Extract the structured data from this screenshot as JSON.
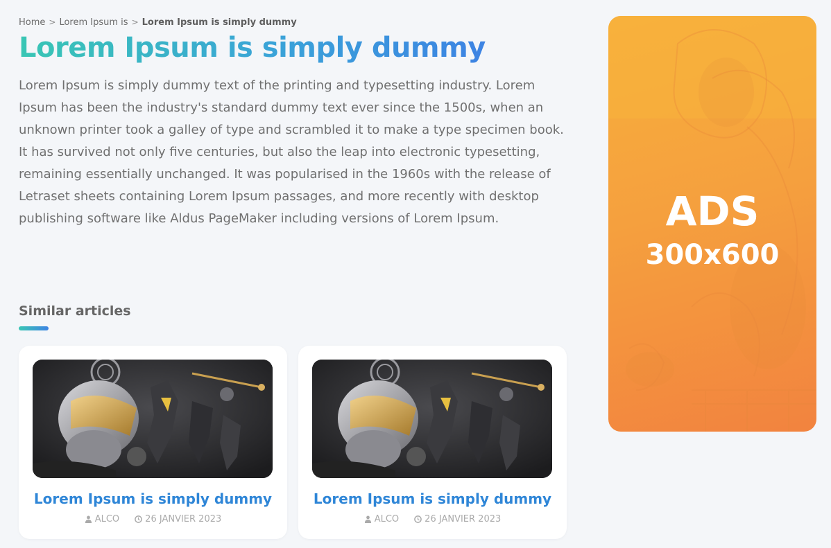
{
  "breadcrumb": {
    "items": [
      {
        "label": "Home"
      },
      {
        "label": "Lorem Ipsum is"
      },
      {
        "label": "Lorem Ipsum is simply dummy"
      }
    ]
  },
  "article": {
    "title": "Lorem Ipsum is simply dummy",
    "body": "Lorem Ipsum is simply dummy text of the printing and typesetting industry. Lorem Ipsum has been the industry's standard dummy text ever since the 1500s, when an unknown printer took a galley of type and scrambled it to make a type specimen book. It has survived not only five centuries, but also the leap into electronic typesetting, remaining essentially unchanged. It was popularised in the 1960s with the release of Letraset sheets containing Lorem Ipsum passages, and more recently with desktop publishing software like Aldus PageMaker including versions of Lorem Ipsum."
  },
  "similar": {
    "heading": "Similar articles",
    "cards": [
      {
        "title": "Lorem Ipsum is simply dummy",
        "author": "ALCO",
        "date": "26 JANVIER 2023",
        "image": "fantasy-heroes-artwork",
        "author_icon": "user-icon",
        "date_icon": "clock-icon"
      },
      {
        "title": "Lorem Ipsum is simply dummy",
        "author": "ALCO",
        "date": "26 JANVIER 2023",
        "image": "fantasy-heroes-artwork",
        "author_icon": "user-icon",
        "date_icon": "clock-icon"
      }
    ]
  },
  "ad": {
    "label": "ADS",
    "size": "300x600"
  },
  "colors": {
    "title_gradient_start": "#39c6b4",
    "title_gradient_end": "#3d83e3",
    "card_title": "#2f86d7",
    "ad_background": "#f5a03e",
    "page_background": "#f4f6f9"
  },
  "icons": {
    "breadcrumb_separator": "chevron-right-icon"
  }
}
